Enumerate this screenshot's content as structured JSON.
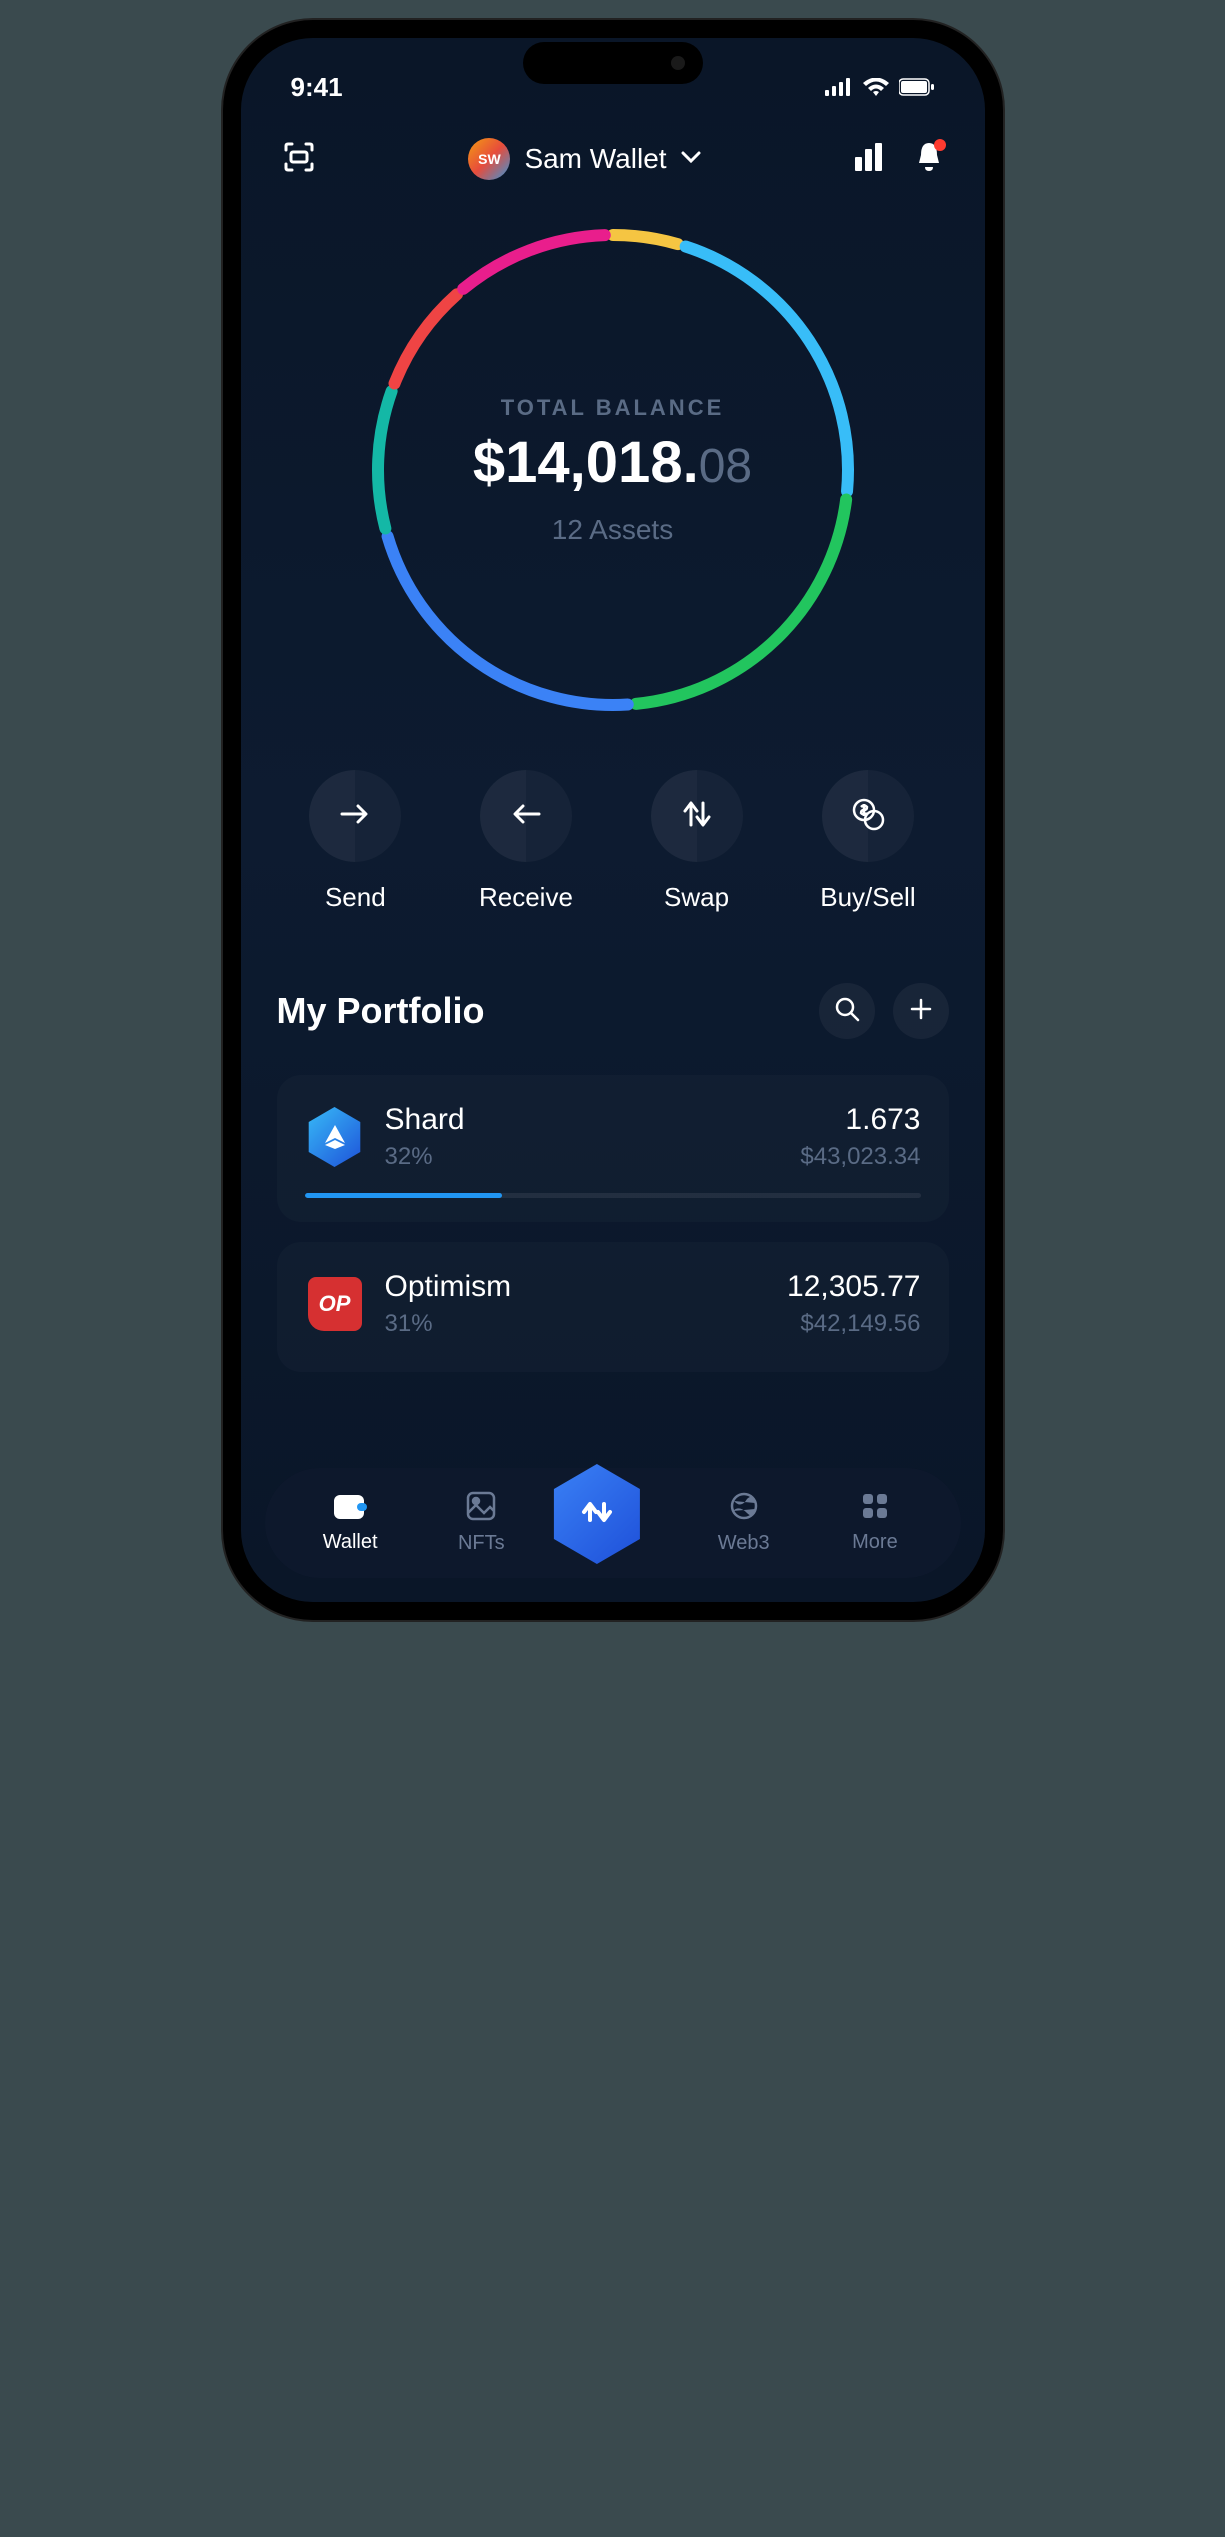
{
  "status": {
    "time": "9:41"
  },
  "header": {
    "wallet_initials": "SW",
    "wallet_name": "Sam Wallet"
  },
  "balance": {
    "label": "TOTAL BALANCE",
    "currency": "$",
    "whole": "14,018.",
    "cents": "08",
    "assets_count": "12 Assets"
  },
  "chart_data": {
    "type": "pie",
    "title": "Portfolio allocation",
    "segments": [
      {
        "name": "Yellow",
        "value": 5,
        "color": "#f5c542"
      },
      {
        "name": "Light Blue",
        "value": 22,
        "color": "#38bdf8"
      },
      {
        "name": "Green",
        "value": 22,
        "color": "#22c55e"
      },
      {
        "name": "Blue",
        "value": 22,
        "color": "#3b82f6"
      },
      {
        "name": "Teal",
        "value": 10,
        "color": "#14b8a6"
      },
      {
        "name": "Red",
        "value": 8,
        "color": "#ef4444"
      },
      {
        "name": "Magenta",
        "value": 11,
        "color": "#e91e8c"
      }
    ]
  },
  "actions": [
    {
      "label": "Send",
      "icon": "arrow-right"
    },
    {
      "label": "Receive",
      "icon": "arrow-left"
    },
    {
      "label": "Swap",
      "icon": "swap"
    },
    {
      "label": "Buy/Sell",
      "icon": "coin"
    }
  ],
  "portfolio": {
    "title": "My Portfolio",
    "assets": [
      {
        "name": "Shard",
        "pct": "32%",
        "qty": "1.673",
        "usd": "$43,023.34",
        "bar": 32,
        "color": "#2196f3",
        "icon": "shard"
      },
      {
        "name": "Optimism",
        "pct": "31%",
        "qty": "12,305.77",
        "usd": "$42,149.56",
        "bar": 31,
        "color": "#d63031",
        "icon": "op"
      }
    ]
  },
  "nav": {
    "items": [
      {
        "label": "Wallet",
        "icon": "wallet",
        "active": true
      },
      {
        "label": "NFTs",
        "icon": "image",
        "active": false
      },
      {
        "label": "",
        "icon": "swap-center",
        "active": false
      },
      {
        "label": "Web3",
        "icon": "globe",
        "active": false
      },
      {
        "label": "More",
        "icon": "grid",
        "active": false
      }
    ]
  }
}
